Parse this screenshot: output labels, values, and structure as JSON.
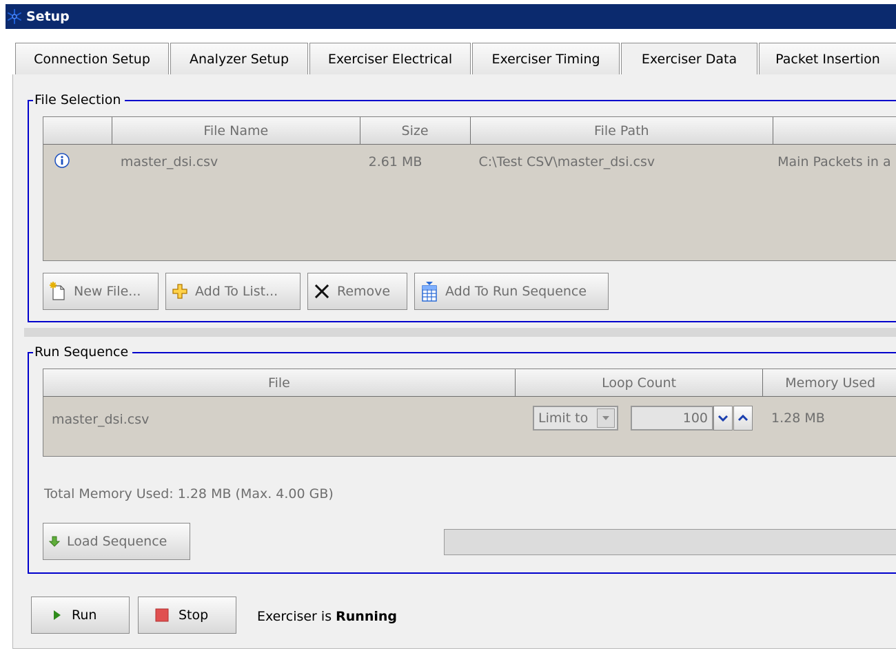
{
  "window": {
    "title": "Setup"
  },
  "tabs": [
    {
      "label": "Connection Setup"
    },
    {
      "label": "Analyzer Setup"
    },
    {
      "label": "Exerciser Electrical"
    },
    {
      "label": "Exerciser Timing"
    },
    {
      "label": "Exerciser Data"
    },
    {
      "label": "Packet Insertion"
    }
  ],
  "active_tab": "Exerciser Data",
  "file_selection": {
    "title": "File Selection",
    "columns": [
      "",
      "File Name",
      "Size",
      "File Path",
      ""
    ],
    "rows": [
      {
        "icon": "info-icon",
        "name": "master_dsi.csv",
        "size": "2.61 MB",
        "path": "C:\\Test CSV\\master_dsi.csv",
        "description": "Main Packets in a"
      }
    ],
    "buttons": {
      "new_file": "New File...",
      "add_to_list": "Add To List...",
      "remove": "Remove",
      "add_to_run_sequence": "Add To Run Sequence"
    }
  },
  "run_sequence": {
    "title": "Run Sequence",
    "columns": [
      "File",
      "Loop Count",
      "Memory Used"
    ],
    "rows": [
      {
        "file": "master_dsi.csv",
        "limit_mode": "Limit to",
        "loop_count": "100",
        "memory": "1.28 MB"
      }
    ],
    "total_memory": "Total Memory Used: 1.28 MB (Max. 4.00 GB)",
    "load_sequence": "Load Sequence"
  },
  "controls": {
    "run": "Run",
    "stop": "Stop",
    "status_prefix": "Exerciser is",
    "status_value": "Running"
  },
  "colors": {
    "title_bar": "#0b2a6e",
    "group_border": "#0000cc",
    "run_icon": "#2e8b1a",
    "stop_icon": "#e05050"
  }
}
